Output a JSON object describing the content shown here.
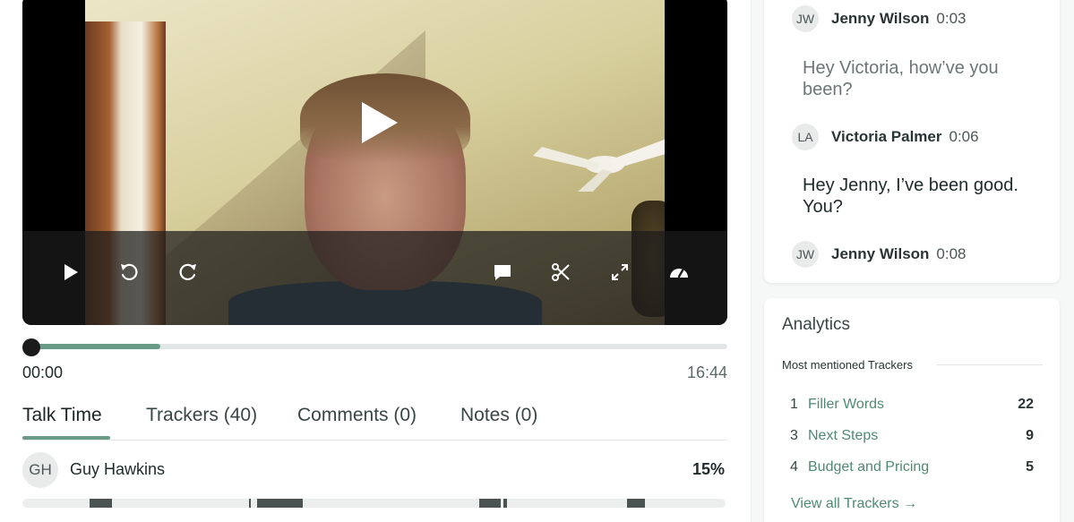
{
  "player": {
    "controls": [
      "play-icon",
      "rewind-icon",
      "forward-icon",
      "comment-icon",
      "scissors-icon",
      "expand-icon",
      "speed-icon"
    ],
    "progress_fraction": 0.19,
    "time_current": "00:00",
    "time_total": "16:44"
  },
  "tabs": [
    {
      "label": "Talk Time",
      "active": true
    },
    {
      "label": "Trackers (40)",
      "active": false
    },
    {
      "label": "Comments (0)",
      "active": false
    },
    {
      "label": "Notes (0)",
      "active": false
    }
  ],
  "talk_time": {
    "speaker_initials": "GH",
    "speaker_name": "Guy Hawkins",
    "percent": "15%"
  },
  "transcript": {
    "entries": [
      {
        "initials": "JW",
        "name": "Jenny Wilson",
        "time": "0:03"
      },
      {
        "message": "Hey Victoria, how’ve you been?"
      },
      {
        "initials": "LA",
        "name": "Victoria Palmer",
        "time": "0:06"
      },
      {
        "message": "Hey Jenny, I’ve been good. You?"
      },
      {
        "initials": "JW",
        "name": "Jenny Wilson",
        "time": "0:08"
      }
    ]
  },
  "analytics": {
    "title": "Analytics",
    "subtitle": "Most mentioned Trackers",
    "trackers": [
      {
        "rank": "1",
        "name": "Filler Words",
        "count": "22"
      },
      {
        "rank": "3",
        "name": "Next Steps",
        "count": "9"
      },
      {
        "rank": "4",
        "name": "Budget and Pricing",
        "count": "5"
      }
    ],
    "view_all": "View all Trackers →"
  },
  "colors": {
    "accent": "#6a9b86",
    "link": "#4f8a72",
    "control_bar": "#1c1c1c"
  }
}
